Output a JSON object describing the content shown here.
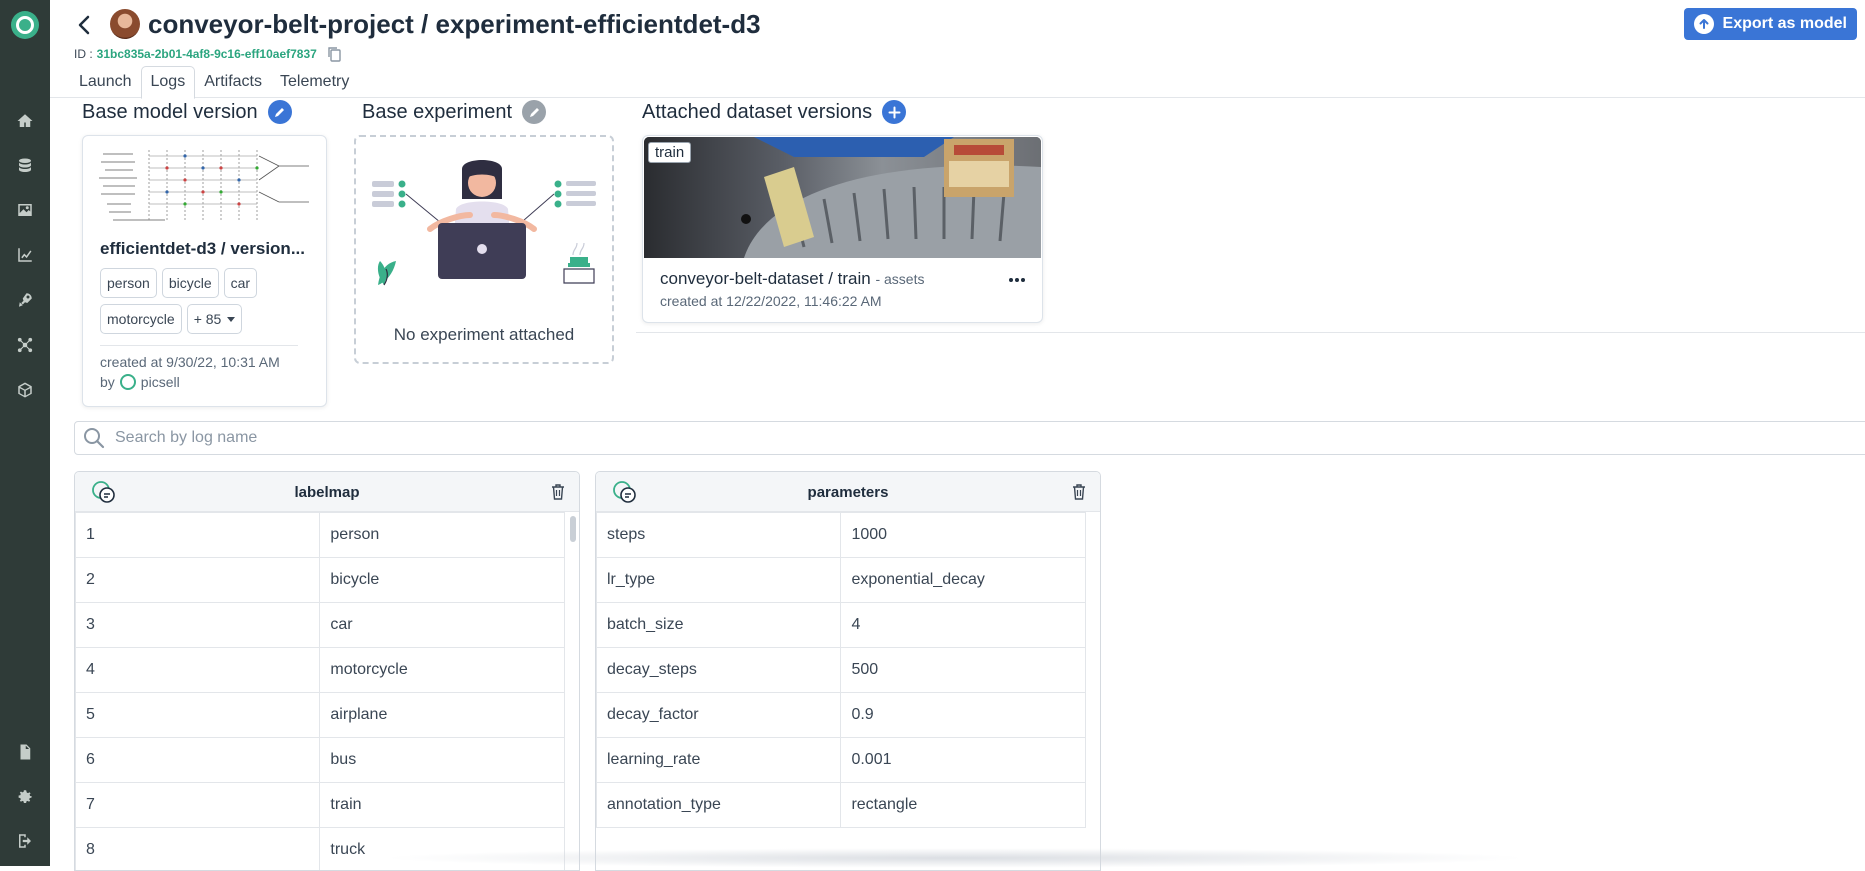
{
  "header": {
    "title": "conveyor-belt-project / experiment-efficientdet-d3",
    "id_label": "ID :",
    "id_value": "31bc835a-2b01-4af8-9c16-eff10aef7837",
    "export_label": "Export as model"
  },
  "tabs": [
    {
      "label": "Launch"
    },
    {
      "label": "Logs",
      "active": true
    },
    {
      "label": "Artifacts"
    },
    {
      "label": "Telemetry"
    }
  ],
  "base_model": {
    "section_title": "Base model version",
    "name": "efficientdet-d3 / version...",
    "labels": [
      "person",
      "bicycle",
      "car",
      "motorcycle"
    ],
    "more_label": "+ 85",
    "created": "created at 9/30/22, 10:31 AM",
    "by_label": "by",
    "author": "picsell"
  },
  "base_experiment": {
    "section_title": "Base experiment",
    "empty_text": "No experiment attached"
  },
  "datasets": {
    "section_title": "Attached dataset versions",
    "items": [
      {
        "badge": "train",
        "name": "conveyor-belt-dataset / train",
        "suffix": "- assets",
        "created": "created at 12/22/2022, 11:46:22 AM"
      }
    ]
  },
  "search": {
    "placeholder": "Search by log name",
    "value": ""
  },
  "logs": {
    "labelmap": {
      "title": "labelmap",
      "rows": [
        [
          "1",
          "person"
        ],
        [
          "2",
          "bicycle"
        ],
        [
          "3",
          "car"
        ],
        [
          "4",
          "motorcycle"
        ],
        [
          "5",
          "airplane"
        ],
        [
          "6",
          "bus"
        ],
        [
          "7",
          "train"
        ],
        [
          "8",
          "truck"
        ]
      ]
    },
    "parameters": {
      "title": "parameters",
      "rows": [
        [
          "steps",
          "1000"
        ],
        [
          "lr_type",
          "exponential_decay"
        ],
        [
          "batch_size",
          "4"
        ],
        [
          "decay_steps",
          "500"
        ],
        [
          "decay_factor",
          "0.9"
        ],
        [
          "learning_rate",
          "0.001"
        ],
        [
          "annotation_type",
          "rectangle"
        ]
      ]
    }
  },
  "sidebar": {
    "icons": [
      "logo-icon",
      "home-icon",
      "database-icon",
      "image-icon",
      "chart-icon",
      "rocket-icon",
      "network-icon",
      "cube-icon",
      "document-icon",
      "gear-icon",
      "logout-icon"
    ]
  },
  "colors": {
    "sidebar_bg": "#2f3b38",
    "brand_green": "#3ab08a",
    "accent_blue": "#3a75d6",
    "id_green": "#2ba57f"
  }
}
